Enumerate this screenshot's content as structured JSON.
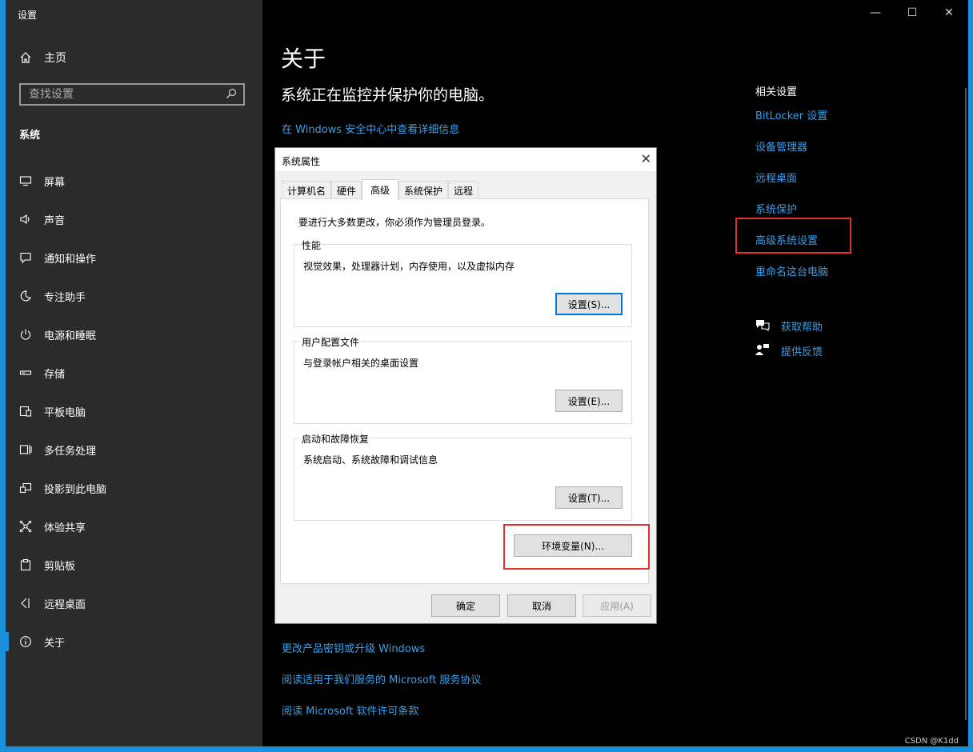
{
  "app_title": "设置",
  "sidebar": {
    "home_label": "主页",
    "search_placeholder": "查找设置",
    "section_title": "系统",
    "items": [
      {
        "label": "屏幕",
        "icon": "monitor-icon"
      },
      {
        "label": "声音",
        "icon": "speaker-icon"
      },
      {
        "label": "通知和操作",
        "icon": "notification-icon"
      },
      {
        "label": "专注助手",
        "icon": "moon-icon"
      },
      {
        "label": "电源和睡眠",
        "icon": "power-icon"
      },
      {
        "label": "存储",
        "icon": "storage-icon"
      },
      {
        "label": "平板电脑",
        "icon": "tablet-icon"
      },
      {
        "label": "多任务处理",
        "icon": "multitask-icon"
      },
      {
        "label": "投影到此电脑",
        "icon": "project-icon"
      },
      {
        "label": "体验共享",
        "icon": "share-icon"
      },
      {
        "label": "剪贴板",
        "icon": "clipboard-icon"
      },
      {
        "label": "远程桌面",
        "icon": "remote-icon"
      },
      {
        "label": "关于",
        "icon": "info-icon",
        "active": true
      }
    ]
  },
  "window_controls": {
    "minimize": "—",
    "maximize": "☐",
    "close": "✕"
  },
  "main": {
    "title": "关于",
    "headline": "系统正在监控并保护你的电脑。",
    "security_link": "在 Windows 安全中心中查看详细信息",
    "bottom_links": [
      "更改产品密钥或升级 Windows",
      "阅读适用于我们服务的 Microsoft 服务协议",
      "阅读 Microsoft 软件许可条款"
    ]
  },
  "related": {
    "title": "相关设置",
    "links": [
      "BitLocker 设置",
      "设备管理器",
      "远程桌面",
      "系统保护",
      "高级系统设置",
      "重命名这台电脑"
    ],
    "help": "获取帮助",
    "feedback": "提供反馈"
  },
  "dialog": {
    "title": "系统属性",
    "close": "✕",
    "tabs": [
      "计算机名",
      "硬件",
      "高级",
      "系统保护",
      "远程"
    ],
    "active_tab": "高级",
    "admin_note": "要进行大多数更改，你必须作为管理员登录。",
    "performance": {
      "label": "性能",
      "desc": "视觉效果，处理器计划，内存使用，以及虚拟内存",
      "button": "设置(S)..."
    },
    "profile": {
      "label": "用户配置文件",
      "desc": "与登录帐户相关的桌面设置",
      "button": "设置(E)..."
    },
    "startup": {
      "label": "启动和故障恢复",
      "desc": "系统启动、系统故障和调试信息",
      "button": "设置(T)..."
    },
    "env_button": "环境变量(N)...",
    "ok": "确定",
    "cancel": "取消",
    "apply": "应用(A)"
  },
  "watermark": "CSDN @K1dd",
  "colors": {
    "accent": "#1a8fdc",
    "link": "#3b9fe8",
    "highlight": "#e0312f"
  }
}
